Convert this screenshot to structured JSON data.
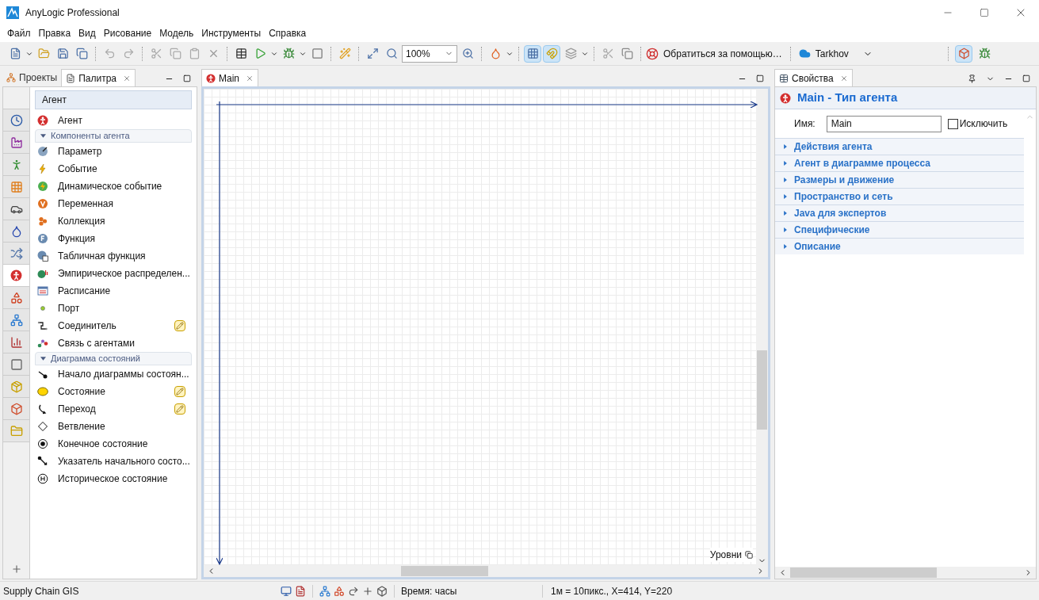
{
  "window": {
    "title": "AnyLogic Professional"
  },
  "menu": [
    "Файл",
    "Правка",
    "Вид",
    "Рисование",
    "Модель",
    "Инструменты",
    "Справка"
  ],
  "toolbar": {
    "zoom": "100%",
    "help_button": "Обратиться за помощью…",
    "user": "Tarkhov",
    "grid_on": true,
    "snap_on": true,
    "perspective_on": true
  },
  "left_tabs": [
    {
      "label": "Проекты",
      "selected": false
    },
    {
      "label": "Палитра",
      "selected": true
    }
  ],
  "palette_tabs": [
    {
      "selected": false
    },
    {
      "selected": false
    },
    {
      "selected": false
    },
    {
      "selected": false
    },
    {
      "selected": false
    },
    {
      "selected": false
    },
    {
      "selected": false
    },
    {
      "selected": true
    },
    {
      "selected": false
    },
    {
      "selected": false
    },
    {
      "selected": false
    },
    {
      "selected": false
    },
    {
      "selected": false
    },
    {
      "selected": false
    },
    {
      "selected": false
    }
  ],
  "palette": {
    "title": "Агент",
    "top_item": "Агент",
    "sections": [
      {
        "title": "Компоненты агента",
        "expanded": true,
        "items": [
          {
            "label": "Параметр",
            "pencil": false
          },
          {
            "label": "Событие",
            "pencil": false
          },
          {
            "label": "Динамическое событие",
            "pencil": false
          },
          {
            "label": "Переменная",
            "pencil": false
          },
          {
            "label": "Коллекция",
            "pencil": false
          },
          {
            "label": "Функция",
            "pencil": false
          },
          {
            "label": "Табличная функция",
            "pencil": false
          },
          {
            "label": "Эмпирическое распределен...",
            "pencil": false
          },
          {
            "label": "Расписание",
            "pencil": false
          },
          {
            "label": "Порт",
            "pencil": false
          },
          {
            "label": "Соединитель",
            "pencil": true
          },
          {
            "label": "Связь с агентами",
            "pencil": false
          }
        ]
      },
      {
        "title": "Диаграмма состояний",
        "expanded": true,
        "items": [
          {
            "label": "Начало диаграммы состоян...",
            "pencil": false
          },
          {
            "label": "Состояние",
            "pencil": true
          },
          {
            "label": "Переход",
            "pencil": true
          },
          {
            "label": "Ветвление",
            "pencil": false
          },
          {
            "label": "Конечное состояние",
            "pencil": false
          },
          {
            "label": "Указатель начального состо...",
            "pencil": false
          },
          {
            "label": "Историческое состояние",
            "pencil": false
          }
        ]
      }
    ]
  },
  "editor": {
    "tab": "Main",
    "levels": "Уровни"
  },
  "properties": {
    "tab": "Свойства",
    "title": "Main - Тип агента",
    "name_label": "Имя:",
    "name_value": "Main",
    "exclude_label": "Исключить",
    "exclude_checked": false,
    "sections": [
      {
        "title": "Действия агента",
        "expanded": false
      },
      {
        "title": "Агент в диаграмме процесса",
        "expanded": false
      },
      {
        "title": "Размеры и движение",
        "expanded": false
      },
      {
        "title": "Пространство и сеть",
        "expanded": false
      },
      {
        "title": "Java для экспертов",
        "expanded": false
      },
      {
        "title": "Специфические",
        "expanded": false
      },
      {
        "title": "Описание",
        "expanded": false
      }
    ]
  },
  "status_bar": {
    "project": "Supply Chain GIS",
    "time": "Время: часы",
    "scale": "1м = 10пикс., X=414, Y=220"
  }
}
